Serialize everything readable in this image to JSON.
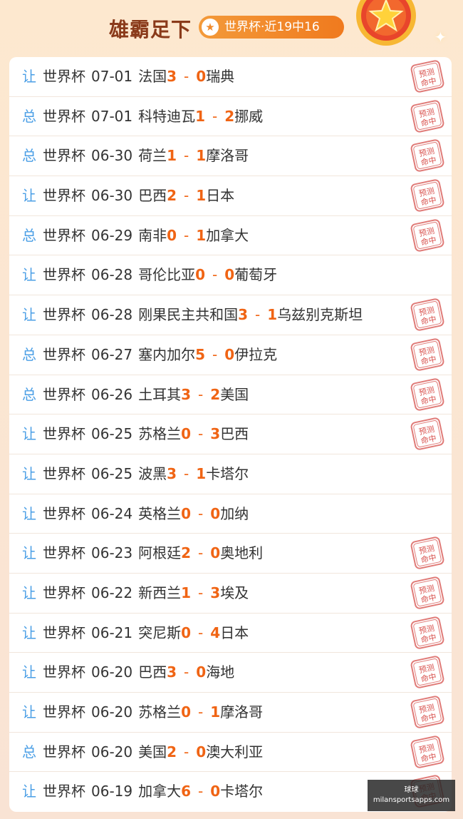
{
  "header": {
    "title": "雄霸足下",
    "badge_text": "世界杯·近19中16",
    "badge_icon": "star-icon",
    "medal_icon": "medal-star-icon"
  },
  "colors": {
    "accent": "#f06414",
    "tag": "#4b9fe6",
    "stamp": "#d9534f"
  },
  "rows": [
    {
      "tag": "让",
      "league": "世界杯",
      "date": "07-01",
      "home": "法国",
      "hs": "3",
      "as": "0",
      "away": "瑞典",
      "hit": true
    },
    {
      "tag": "总",
      "league": "世界杯",
      "date": "07-01",
      "home": "科特迪瓦",
      "hs": "1",
      "as": "2",
      "away": "挪威",
      "hit": true
    },
    {
      "tag": "总",
      "league": "世界杯",
      "date": "06-30",
      "home": "荷兰",
      "hs": "1",
      "as": "1",
      "away": "摩洛哥",
      "hit": true
    },
    {
      "tag": "让",
      "league": "世界杯",
      "date": "06-30",
      "home": "巴西",
      "hs": "2",
      "as": "1",
      "away": "日本",
      "hit": true
    },
    {
      "tag": "总",
      "league": "世界杯",
      "date": "06-29",
      "home": "南非",
      "hs": "0",
      "as": "1",
      "away": "加拿大",
      "hit": true
    },
    {
      "tag": "让",
      "league": "世界杯",
      "date": "06-28",
      "home": "哥伦比亚",
      "hs": "0",
      "as": "0",
      "away": "葡萄牙",
      "hit": false
    },
    {
      "tag": "让",
      "league": "世界杯",
      "date": "06-28",
      "home": "刚果民主共和国",
      "hs": "3",
      "as": "1",
      "away": "乌兹别克斯坦",
      "hit": true
    },
    {
      "tag": "总",
      "league": "世界杯",
      "date": "06-27",
      "home": "塞内加尔",
      "hs": "5",
      "as": "0",
      "away": "伊拉克",
      "hit": true
    },
    {
      "tag": "总",
      "league": "世界杯",
      "date": "06-26",
      "home": "土耳其",
      "hs": "3",
      "as": "2",
      "away": "美国",
      "hit": true
    },
    {
      "tag": "让",
      "league": "世界杯",
      "date": "06-25",
      "home": "苏格兰",
      "hs": "0",
      "as": "3",
      "away": "巴西",
      "hit": true
    },
    {
      "tag": "让",
      "league": "世界杯",
      "date": "06-25",
      "home": "波黑",
      "hs": "3",
      "as": "1",
      "away": "卡塔尔",
      "hit": false
    },
    {
      "tag": "让",
      "league": "世界杯",
      "date": "06-24",
      "home": "英格兰",
      "hs": "0",
      "as": "0",
      "away": "加纳",
      "hit": false
    },
    {
      "tag": "让",
      "league": "世界杯",
      "date": "06-23",
      "home": "阿根廷",
      "hs": "2",
      "as": "0",
      "away": "奥地利",
      "hit": true
    },
    {
      "tag": "让",
      "league": "世界杯",
      "date": "06-22",
      "home": "新西兰",
      "hs": "1",
      "as": "3",
      "away": "埃及",
      "hit": true
    },
    {
      "tag": "让",
      "league": "世界杯",
      "date": "06-21",
      "home": "突尼斯",
      "hs": "0",
      "as": "4",
      "away": "日本",
      "hit": true
    },
    {
      "tag": "让",
      "league": "世界杯",
      "date": "06-20",
      "home": "巴西",
      "hs": "3",
      "as": "0",
      "away": "海地",
      "hit": true
    },
    {
      "tag": "让",
      "league": "世界杯",
      "date": "06-20",
      "home": "苏格兰",
      "hs": "0",
      "as": "1",
      "away": "摩洛哥",
      "hit": true
    },
    {
      "tag": "总",
      "league": "世界杯",
      "date": "06-20",
      "home": "美国",
      "hs": "2",
      "as": "0",
      "away": "澳大利亚",
      "hit": true
    },
    {
      "tag": "让",
      "league": "世界杯",
      "date": "06-19",
      "home": "加拿大",
      "hs": "6",
      "as": "0",
      "away": "卡塔尔",
      "hit": true
    }
  ],
  "stamp": {
    "line1": "预测",
    "line2": "命中"
  },
  "watermark": {
    "line1": "球球",
    "line2": "milansportsapps.com"
  }
}
